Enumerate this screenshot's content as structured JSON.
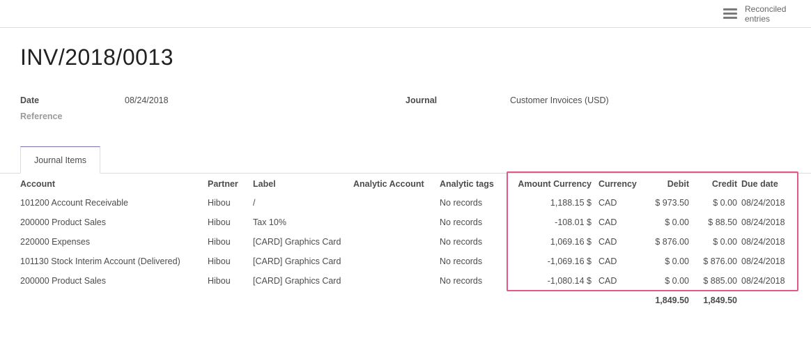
{
  "control_panel": {
    "smart_button_label_line1": "Reconciled",
    "smart_button_label_line2": "entries"
  },
  "move": {
    "name": "INV/2018/0013",
    "date_label": "Date",
    "date_value": "08/24/2018",
    "reference_label": "Reference",
    "reference_value": "",
    "journal_label": "Journal",
    "journal_value": "Customer Invoices (USD)"
  },
  "tabs": [
    {
      "label": "Journal Items",
      "active": true
    }
  ],
  "table": {
    "headers": {
      "account": "Account",
      "partner": "Partner",
      "label": "Label",
      "analytic_account": "Analytic Account",
      "analytic_tags": "Analytic tags",
      "amount_currency": "Amount Currency",
      "currency": "Currency",
      "debit": "Debit",
      "credit": "Credit",
      "due_date": "Due date"
    },
    "rows": [
      {
        "account": "101200 Account Receivable",
        "partner": "Hibou",
        "label": "/",
        "analytic_account": "",
        "analytic_tags": "No records",
        "amount_currency": "1,188.15 $",
        "currency": "CAD",
        "debit": "$ 973.50",
        "credit": "$ 0.00",
        "due_date": "08/24/2018"
      },
      {
        "account": "200000 Product Sales",
        "partner": "Hibou",
        "label": "Tax 10%",
        "analytic_account": "",
        "analytic_tags": "No records",
        "amount_currency": "-108.01 $",
        "currency": "CAD",
        "debit": "$ 0.00",
        "credit": "$ 88.50",
        "due_date": "08/24/2018"
      },
      {
        "account": "220000 Expenses",
        "partner": "Hibou",
        "label": "[CARD] Graphics Card",
        "analytic_account": "",
        "analytic_tags": "No records",
        "amount_currency": "1,069.16 $",
        "currency": "CAD",
        "debit": "$ 876.00",
        "credit": "$ 0.00",
        "due_date": "08/24/2018"
      },
      {
        "account": "101130 Stock Interim Account (Delivered)",
        "partner": "Hibou",
        "label": "[CARD] Graphics Card",
        "analytic_account": "",
        "analytic_tags": "No records",
        "amount_currency": "-1,069.16 $",
        "currency": "CAD",
        "debit": "$ 0.00",
        "credit": "$ 876.00",
        "due_date": "08/24/2018"
      },
      {
        "account": "200000 Product Sales",
        "partner": "Hibou",
        "label": "[CARD] Graphics Card",
        "analytic_account": "",
        "analytic_tags": "No records",
        "amount_currency": "-1,080.14 $",
        "currency": "CAD",
        "debit": "$ 0.00",
        "credit": "$ 885.00",
        "due_date": "08/24/2018"
      }
    ],
    "totals": {
      "debit": "1,849.50",
      "credit": "1,849.50"
    }
  },
  "highlight_color": "#e15a85"
}
